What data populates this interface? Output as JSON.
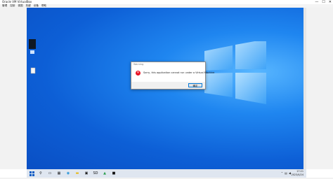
{
  "host_window": {
    "title": "Oracle VM VirtualBox",
    "controls": {
      "minimize": "—",
      "maximize": "☐",
      "close": "✕"
    },
    "menu": [
      "管理",
      "控制",
      "视图",
      "热键",
      "设备",
      "帮助"
    ]
  },
  "dialog": {
    "title": "Warning",
    "message": "Sorry, this application cannot run under a Virtual Machine",
    "ok_label": "确定"
  },
  "taskbar": {
    "icons": [
      "start-icon",
      "search-icon",
      "task-view-icon",
      "widgets-icon",
      "edge-icon",
      "file-explorer-icon",
      "store-icon",
      "sd-app-icon",
      "app-icon",
      "terminal-icon"
    ],
    "sd_label": "SD",
    "tray": {
      "time": "17:21",
      "date": "2023/4/24"
    }
  },
  "colors": {
    "desktop": "#0d5fd6",
    "error": "#e81123",
    "accent": "#0078d7"
  }
}
